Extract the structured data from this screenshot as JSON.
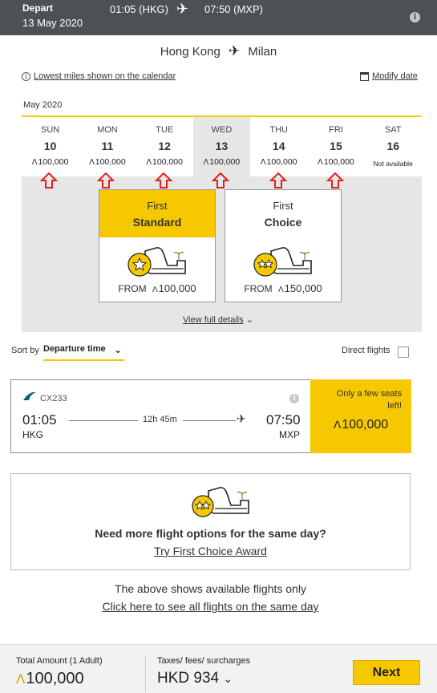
{
  "header": {
    "depart_label": "Depart",
    "date": "13 May 2020",
    "departure": "01:05 (HKG)",
    "arrival": "07:50 (MXP)",
    "plane_icon": "airplane-icon",
    "info_icon": "info-icon"
  },
  "route": {
    "origin": "Hong Kong",
    "destination": "Milan"
  },
  "links": {
    "lowest_miles": "Lowest miles shown on the calendar",
    "modify_date": "Modify date"
  },
  "calendar": {
    "month": "May 2020",
    "days": [
      {
        "name": "SUN",
        "date": "10",
        "miles": "100,000"
      },
      {
        "name": "MON",
        "date": "11",
        "miles": "100,000"
      },
      {
        "name": "TUE",
        "date": "12",
        "miles": "100,000"
      },
      {
        "name": "WED",
        "date": "13",
        "miles": "100,000"
      },
      {
        "name": "THU",
        "date": "14",
        "miles": "100,000"
      },
      {
        "name": "FRI",
        "date": "15",
        "miles": "100,000"
      },
      {
        "name": "SAT",
        "date": "16",
        "status": "Not available"
      }
    ],
    "selected_index": 3
  },
  "fares": [
    {
      "cabin": "First",
      "product": "Standard",
      "from_label": "FROM",
      "miles": "100,000"
    },
    {
      "cabin": "First",
      "product": "Choice",
      "from_label": "FROM",
      "miles": "150,000"
    }
  ],
  "view_full_details": "View full details",
  "sort": {
    "label": "Sort by",
    "value": "Departure time"
  },
  "direct_flights_label": "Direct flights",
  "flight": {
    "number": "CX233",
    "depart_time": "01:05",
    "depart_code": "HKG",
    "duration": "12h 45m",
    "arrive_time": "07:50",
    "arrive_code": "MXP",
    "availability": "Only a few seats left!",
    "miles": "100,000"
  },
  "more_options": {
    "question": "Need more flight options for the same day?",
    "link": "Try First Choice Award"
  },
  "notes": {
    "available_only": "The above shows available flights only",
    "see_all": "Click here to see all flights on the same day"
  },
  "footer": {
    "total_label": "Total Amount (1 Adult)",
    "total_miles": "100,000",
    "taxes_label": "Taxes/ fees/ surcharges",
    "taxes_amount": "HKD 934",
    "next_label": "Next"
  },
  "colors": {
    "accent": "#f6c800",
    "header_bg": "#4d5156",
    "arrow": "#e02020",
    "panel": "#e6e6e6"
  }
}
